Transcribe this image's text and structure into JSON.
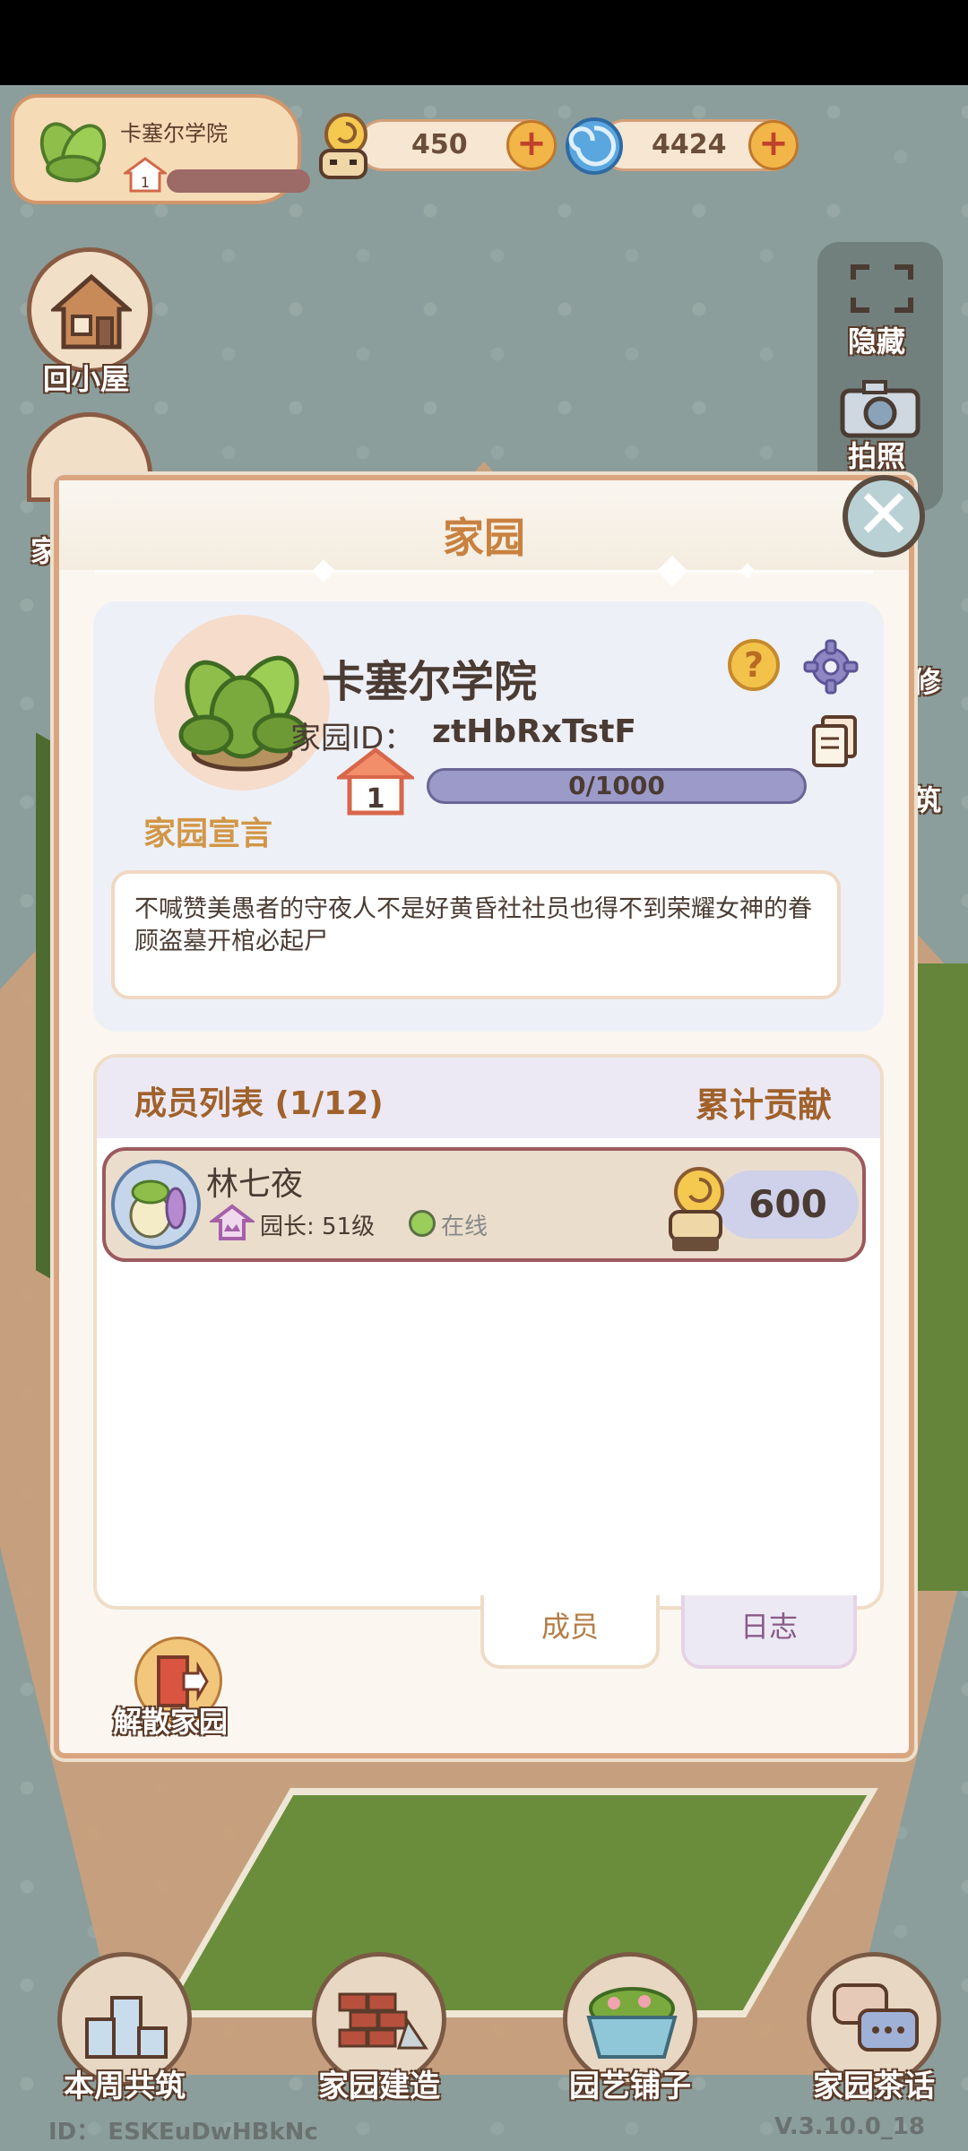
{
  "hud": {
    "garden_name": "卡塞尔学院",
    "garden_level": "1",
    "currency_snail": "450",
    "currency_swirl": "4424"
  },
  "side_buttons": {
    "hide": "隐藏",
    "photo": "拍照",
    "home": "回小屋",
    "edge_char_1": "家",
    "edge_char_2": "修",
    "edge_char_3": "筑"
  },
  "dialog": {
    "title": "家园",
    "garden_name": "卡塞尔学院",
    "garden_id_label": "家园ID：",
    "garden_id_value": "ztHbRxTstF",
    "level": "1",
    "progress": "0/1000",
    "declaration_label": "家园宣言",
    "declaration_text": "不喊赞美愚者的守夜人不是好黄昏社社员也得不到荣耀女神的眷顾盗墓开棺必起尸",
    "members_title": "成员列表 (1/12)",
    "contribution_header": "累计贡献",
    "members": [
      {
        "name": "林七夜",
        "role": "园长: 51级",
        "status": "在线",
        "contribution": "600"
      }
    ],
    "tabs": {
      "members": "成员",
      "log": "日志"
    },
    "disband": "解散家园"
  },
  "bottom_nav": {
    "weekly": "本周共筑",
    "build": "家园建造",
    "shop": "园艺铺子",
    "chat": "家园茶话"
  },
  "footer": {
    "id": "ID： ESKEuDwHBkNc",
    "version": "V.3.10.0_18"
  },
  "colors": {
    "accent_orange": "#c9813f",
    "dialog_border": "#d9a580",
    "progress_bar": "#9c9ac8",
    "online": "#9acd5a"
  }
}
